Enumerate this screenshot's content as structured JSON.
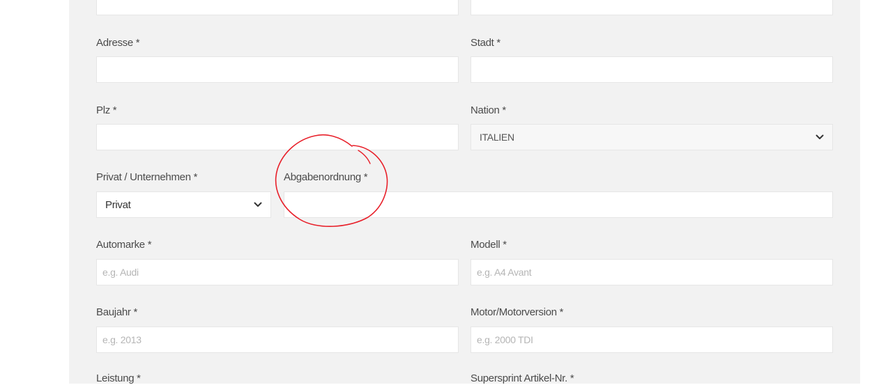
{
  "form": {
    "address": {
      "label": "Adresse *",
      "value": ""
    },
    "city": {
      "label": "Stadt *",
      "value": ""
    },
    "zip": {
      "label": "Plz *",
      "value": ""
    },
    "nation": {
      "label": "Nation *",
      "selected": "ITALIEN"
    },
    "customer_type": {
      "label": "Privat / Unternehmen *",
      "selected": "Privat"
    },
    "tax_code": {
      "label": "Abgabenordnung *",
      "value": ""
    },
    "car_brand": {
      "label": "Automarke *",
      "placeholder": "e.g. Audi"
    },
    "model": {
      "label": "Modell *",
      "placeholder": "e.g. A4 Avant"
    },
    "year": {
      "label": "Baujahr *",
      "placeholder": "e.g. 2013"
    },
    "engine": {
      "label": "Motor/Motorversion *",
      "placeholder": "e.g. 2000 TDI"
    },
    "power": {
      "label": "Leistung *"
    },
    "article_no": {
      "label": "Supersprint Artikel-Nr. *"
    }
  },
  "icons": {
    "select_chevron": "chevron-down-icon",
    "annotation": "red-circle-annotation"
  },
  "colors": {
    "panel_bg": "#f2f2f2",
    "field_bg": "#ffffff",
    "label_text": "#4b4b4b",
    "placeholder": "#b5b5b5",
    "annotation": "#e8202a"
  }
}
